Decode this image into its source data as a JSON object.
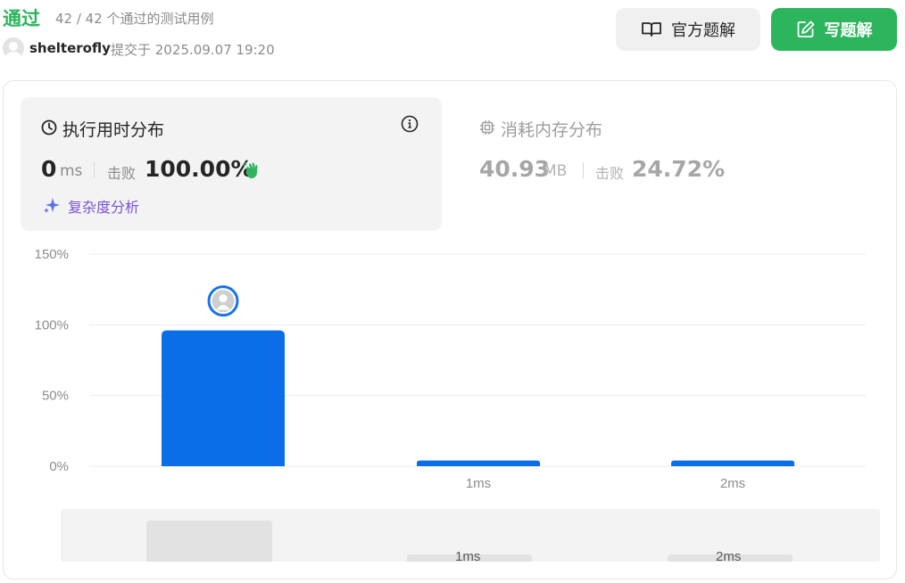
{
  "header": {
    "status": "通过",
    "cases": "42 / 42 个通过的测试用例",
    "username": "shelterofly",
    "submitted": "提交于 2025.09.07 19:20",
    "official_solution_label": "官方题解",
    "write_solution_label": "写题解",
    "accent_color": "#2db55d"
  },
  "runtime": {
    "title": "执行用时分布",
    "value": "0",
    "unit": "ms",
    "beats_label": "击败",
    "beats_value": "100.00%",
    "complexity_link": "复杂度分析",
    "icons": [
      "clock-icon",
      "info-icon",
      "clap-icon",
      "sparkle-icon"
    ]
  },
  "memory": {
    "title": "消耗内存分布",
    "value": "40.93",
    "unit": "MB",
    "beats_label": "击败",
    "beats_value": "24.72%",
    "icon": "chip-icon"
  },
  "chart_data": {
    "type": "bar",
    "categories": [
      "",
      "1ms",
      "2ms"
    ],
    "values": [
      96,
      4,
      4
    ],
    "ylim": [
      0,
      150
    ],
    "yticks": [
      "0%",
      "50%",
      "100%",
      "150%"
    ],
    "bar_color": "#0a6fe6",
    "grid": true,
    "marker": "user-avatar on first bar"
  },
  "overview": {
    "labels": [
      "1ms",
      "2ms"
    ],
    "values": [
      96,
      4,
      4
    ]
  }
}
